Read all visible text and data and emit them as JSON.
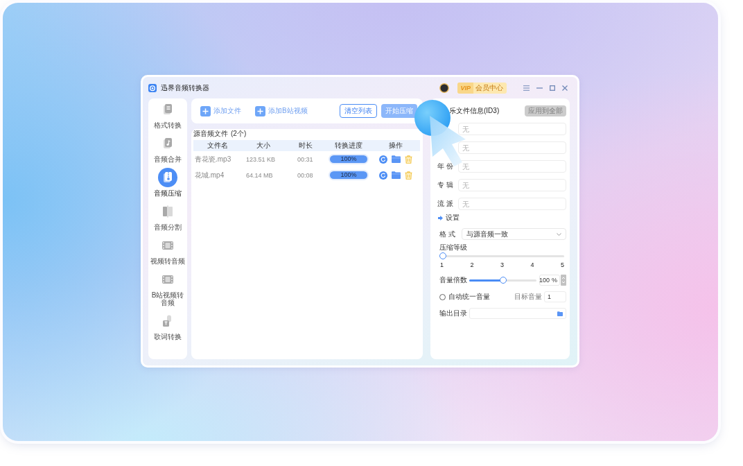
{
  "window": {
    "title": "迅界音频转换器",
    "member_button": {
      "logo": "VIP",
      "label": "会员中心"
    }
  },
  "sidebar": {
    "items": [
      {
        "label": "格式转换",
        "selected": false
      },
      {
        "label": "音频合并",
        "selected": false
      },
      {
        "label": "音频压缩",
        "selected": true
      },
      {
        "label": "音频分割",
        "selected": false
      },
      {
        "label": "视频转音频",
        "selected": false
      },
      {
        "label": "B站视频转音频",
        "selected": false
      },
      {
        "label": "歌词转换",
        "selected": false
      }
    ]
  },
  "toolbar": {
    "buttons": [
      {
        "label": "添加文件",
        "kind": "add"
      },
      {
        "label": "添加B站视频",
        "kind": "add"
      },
      {
        "label": "清空列表",
        "kind": "outline"
      },
      {
        "label": "开始压缩",
        "kind": "primary"
      }
    ]
  },
  "file_list": {
    "title": "源音频文件",
    "count": "(2个)",
    "columns": [
      "文件名",
      "大小",
      "时长",
      "转换进度",
      "操作"
    ],
    "rows": [
      {
        "name": "青花瓷.mp3",
        "size": "123.51 KB",
        "duration": "00:31",
        "progress": {
          "level": 1,
          "reading": "100%"
        }
      },
      {
        "name": "花城.mp4",
        "size": "64.14 MB",
        "duration": "00:08",
        "progress": {
          "level": 1,
          "reading": "100%"
        }
      }
    ]
  },
  "id3_panel": {
    "title": "乐文件信息(ID3)",
    "apply_button": "应用到全部",
    "fields": [
      {
        "placeholder": "无"
      },
      {
        "placeholder": "无"
      },
      {
        "label": "年 份",
        "placeholder": "无"
      },
      {
        "label": "专 辑",
        "placeholder": "无"
      },
      {
        "label": "流 派",
        "placeholder": "无"
      }
    ]
  },
  "settings": {
    "title": "设置",
    "format": {
      "label": "格 式",
      "value": "与源音频一致"
    },
    "compression": {
      "label": "压缩等级",
      "level": 0,
      "ticks": [
        "1",
        "2",
        "3",
        "4",
        "5"
      ]
    },
    "volume": {
      "label": "音量倍数",
      "level": 0.5,
      "value": "100",
      "unit": "%"
    },
    "auto_volume": {
      "label": "自动统一音量",
      "checked": false,
      "target_label": "目标音量",
      "target_value": "1"
    },
    "output": {
      "label": "输出目录"
    }
  }
}
